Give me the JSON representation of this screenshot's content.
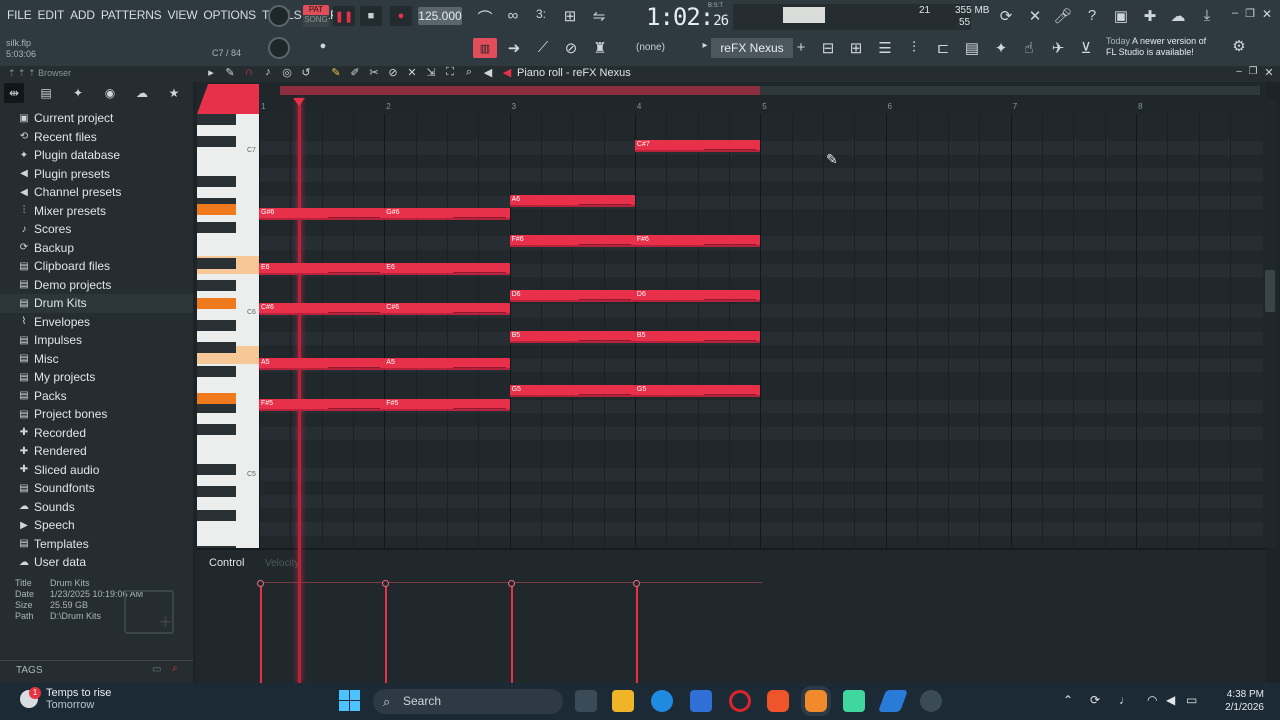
{
  "menu": [
    "FILE",
    "EDIT",
    "ADD",
    "PATTERNS",
    "VIEW",
    "OPTIONS",
    "TOOLS",
    "HELP"
  ],
  "project": {
    "file": "silk.flp",
    "time": "5:03:06",
    "pattern_info": "C7 / 84"
  },
  "transport": {
    "pat_label": "PAT",
    "song_label": "SONG",
    "tempo": "125.000",
    "time_main": "1:02",
    "time_small": "26",
    "time_unit": "B:S:T"
  },
  "monitor": {
    "memory": "355 MB",
    "cpu_val": "21",
    "poly": "55"
  },
  "toolbar2": {
    "none_label": "(none)",
    "plugin": "reFX Nexus"
  },
  "news": {
    "today": "Today",
    "line1": "A newer version of",
    "line2": "FL Studio is available!"
  },
  "browser": {
    "title": "Browser",
    "items": [
      {
        "icon": "▣",
        "label": "Current project"
      },
      {
        "icon": "⟲",
        "label": "Recent files"
      },
      {
        "icon": "✦",
        "label": "Plugin database"
      },
      {
        "icon": "◀",
        "label": "Plugin presets"
      },
      {
        "icon": "◀",
        "label": "Channel presets"
      },
      {
        "icon": "⫶",
        "label": "Mixer presets"
      },
      {
        "icon": "♪",
        "label": "Scores"
      },
      {
        "icon": "⟳",
        "label": "Backup"
      },
      {
        "icon": "▤",
        "label": "Clipboard files"
      },
      {
        "icon": "▤",
        "label": "Demo projects"
      },
      {
        "icon": "▤",
        "label": "Drum Kits"
      },
      {
        "icon": "⌇",
        "label": "Envelopes"
      },
      {
        "icon": "▤",
        "label": "Impulses"
      },
      {
        "icon": "▤",
        "label": "Misc"
      },
      {
        "icon": "▤",
        "label": "My projects"
      },
      {
        "icon": "▤",
        "label": "Packs"
      },
      {
        "icon": "▤",
        "label": "Project bones"
      },
      {
        "icon": "✚",
        "label": "Recorded"
      },
      {
        "icon": "✚",
        "label": "Rendered"
      },
      {
        "icon": "✚",
        "label": "Sliced audio"
      },
      {
        "icon": "▤",
        "label": "Soundfonts"
      },
      {
        "icon": "☁",
        "label": "Sounds"
      },
      {
        "icon": "▶",
        "label": "Speech"
      },
      {
        "icon": "▤",
        "label": "Templates"
      },
      {
        "icon": "☁",
        "label": "User data"
      }
    ],
    "selected_index": 10,
    "info": {
      "title_k": "Title",
      "title_v": "Drum Kits",
      "date_k": "Date",
      "date_v": "1/23/2025 10:19:06 AM",
      "size_k": "Size",
      "size_v": "25.59 GB",
      "path_k": "Path",
      "path_v": "D:\\Drum Kits"
    },
    "tags_label": "TAGS"
  },
  "piano_roll": {
    "title": "Piano roll - reFX Nexus",
    "bar_numbers": [
      "1",
      "2",
      "3",
      "4",
      "5",
      "6",
      "7",
      "8"
    ],
    "key_labels": {
      "c7": "C7",
      "c6": "C6",
      "c5": "C5"
    },
    "notes": [
      {
        "name": "C#7",
        "row": 2,
        "start": 3,
        "len": 1
      },
      {
        "name": "A6",
        "row": 6,
        "start": 2,
        "len": 1
      },
      {
        "name": "G#6",
        "row": 7,
        "start": 0,
        "len": 1
      },
      {
        "name": "G#6",
        "row": 7,
        "start": 1,
        "len": 1
      },
      {
        "name": "F#6",
        "row": 9,
        "start": 2,
        "len": 1
      },
      {
        "name": "F#6",
        "row": 9,
        "start": 3,
        "len": 1
      },
      {
        "name": "E6",
        "row": 11,
        "start": 0,
        "len": 1
      },
      {
        "name": "E6",
        "row": 11,
        "start": 1,
        "len": 1
      },
      {
        "name": "D6",
        "row": 13,
        "start": 2,
        "len": 1
      },
      {
        "name": "D6",
        "row": 13,
        "start": 3,
        "len": 1
      },
      {
        "name": "C#6",
        "row": 14,
        "start": 0,
        "len": 1
      },
      {
        "name": "C#6",
        "row": 14,
        "start": 1,
        "len": 1
      },
      {
        "name": "B5",
        "row": 16,
        "start": 2,
        "len": 1
      },
      {
        "name": "B5",
        "row": 16,
        "start": 3,
        "len": 1
      },
      {
        "name": "A5",
        "row": 18,
        "start": 0,
        "len": 1
      },
      {
        "name": "A5",
        "row": 18,
        "start": 1,
        "len": 1
      },
      {
        "name": "G5",
        "row": 20,
        "start": 2,
        "len": 1
      },
      {
        "name": "G5",
        "row": 20,
        "start": 3,
        "len": 1
      },
      {
        "name": "F#5",
        "row": 21,
        "start": 0,
        "len": 1
      },
      {
        "name": "F#5",
        "row": 21,
        "start": 1,
        "len": 1
      }
    ],
    "control_label": "Control",
    "control_target": "Velocity"
  },
  "taskbar": {
    "weather_title": "Temps to rise",
    "weather_sub": "Tomorrow",
    "badge": "1",
    "search": "Search",
    "time": "4:38 PM",
    "date": "2/1/2026"
  },
  "colors": {
    "accent": "#e8304a",
    "note": "#e8304a",
    "orange": "#ef7a1e",
    "bg": "#1d2428"
  }
}
